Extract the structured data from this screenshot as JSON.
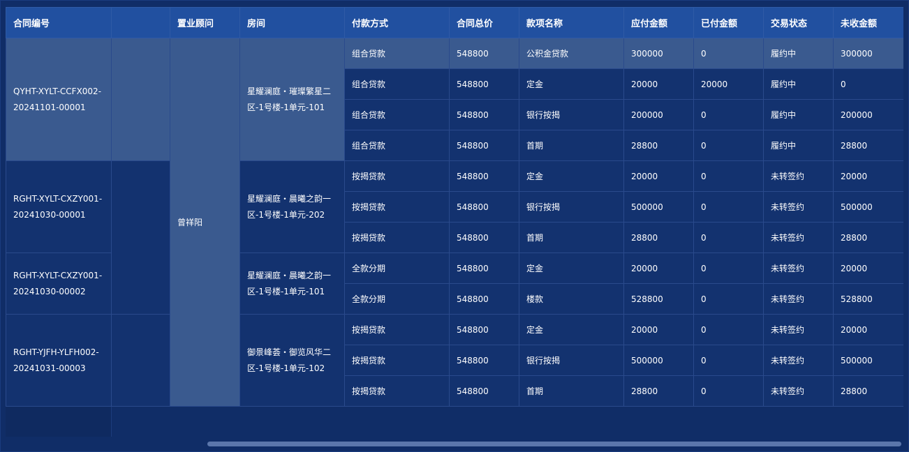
{
  "table": {
    "headers": [
      "合同编号",
      "",
      "置业顾问",
      "房间",
      "付款方式",
      "合同总价",
      "款项名称",
      "应付金额",
      "已付金额",
      "交易状态",
      "未收金额"
    ],
    "advisor": "曾祥阳",
    "groups": [
      {
        "contract": "QYHT-XYLT-CCFX002-20241101-00001",
        "room": "星耀澜庭・璀璨繁星二区-1号楼-1单元-101",
        "rows": [
          {
            "pay": "组合贷款",
            "total": "548800",
            "item": "公积金贷款",
            "due": "300000",
            "paid": "0",
            "status": "履约中",
            "unpaid": "300000"
          },
          {
            "pay": "组合贷款",
            "total": "548800",
            "item": "定金",
            "due": "20000",
            "paid": "20000",
            "status": "履约中",
            "unpaid": "0"
          },
          {
            "pay": "组合贷款",
            "total": "548800",
            "item": "银行按揭",
            "due": "200000",
            "paid": "0",
            "status": "履约中",
            "unpaid": "200000"
          },
          {
            "pay": "组合贷款",
            "total": "548800",
            "item": "首期",
            "due": "28800",
            "paid": "0",
            "status": "履约中",
            "unpaid": "28800"
          }
        ]
      },
      {
        "contract": "RGHT-XYLT-CXZY001-20241030-00001",
        "room": "星耀澜庭・晨曦之韵一区-1号楼-1单元-202",
        "rows": [
          {
            "pay": "按揭贷款",
            "total": "548800",
            "item": "定金",
            "due": "20000",
            "paid": "0",
            "status": "未转签约",
            "unpaid": "20000"
          },
          {
            "pay": "按揭贷款",
            "total": "548800",
            "item": "银行按揭",
            "due": "500000",
            "paid": "0",
            "status": "未转签约",
            "unpaid": "500000"
          },
          {
            "pay": "按揭贷款",
            "total": "548800",
            "item": "首期",
            "due": "28800",
            "paid": "0",
            "status": "未转签约",
            "unpaid": "28800"
          }
        ]
      },
      {
        "contract": "RGHT-XYLT-CXZY001-20241030-00002",
        "room": "星耀澜庭・晨曦之韵一区-1号楼-1单元-101",
        "rows": [
          {
            "pay": "全款分期",
            "total": "548800",
            "item": "定金",
            "due": "20000",
            "paid": "0",
            "status": "未转签约",
            "unpaid": "20000"
          },
          {
            "pay": "全款分期",
            "total": "548800",
            "item": "楼款",
            "due": "528800",
            "paid": "0",
            "status": "未转签约",
            "unpaid": "528800"
          }
        ]
      },
      {
        "contract": "RGHT-YJFH-YLFH002-20241031-00003",
        "room": "御景峰荟・御览风华二区-1号楼-1单元-102",
        "rows": [
          {
            "pay": "按揭贷款",
            "total": "548800",
            "item": "定金",
            "due": "20000",
            "paid": "0",
            "status": "未转签约",
            "unpaid": "20000"
          },
          {
            "pay": "按揭贷款",
            "total": "548800",
            "item": "银行按揭",
            "due": "500000",
            "paid": "0",
            "status": "未转签约",
            "unpaid": "500000"
          },
          {
            "pay": "按揭贷款",
            "total": "548800",
            "item": "首期",
            "due": "28800",
            "paid": "0",
            "status": "未转签约",
            "unpaid": "28800"
          }
        ]
      }
    ]
  }
}
